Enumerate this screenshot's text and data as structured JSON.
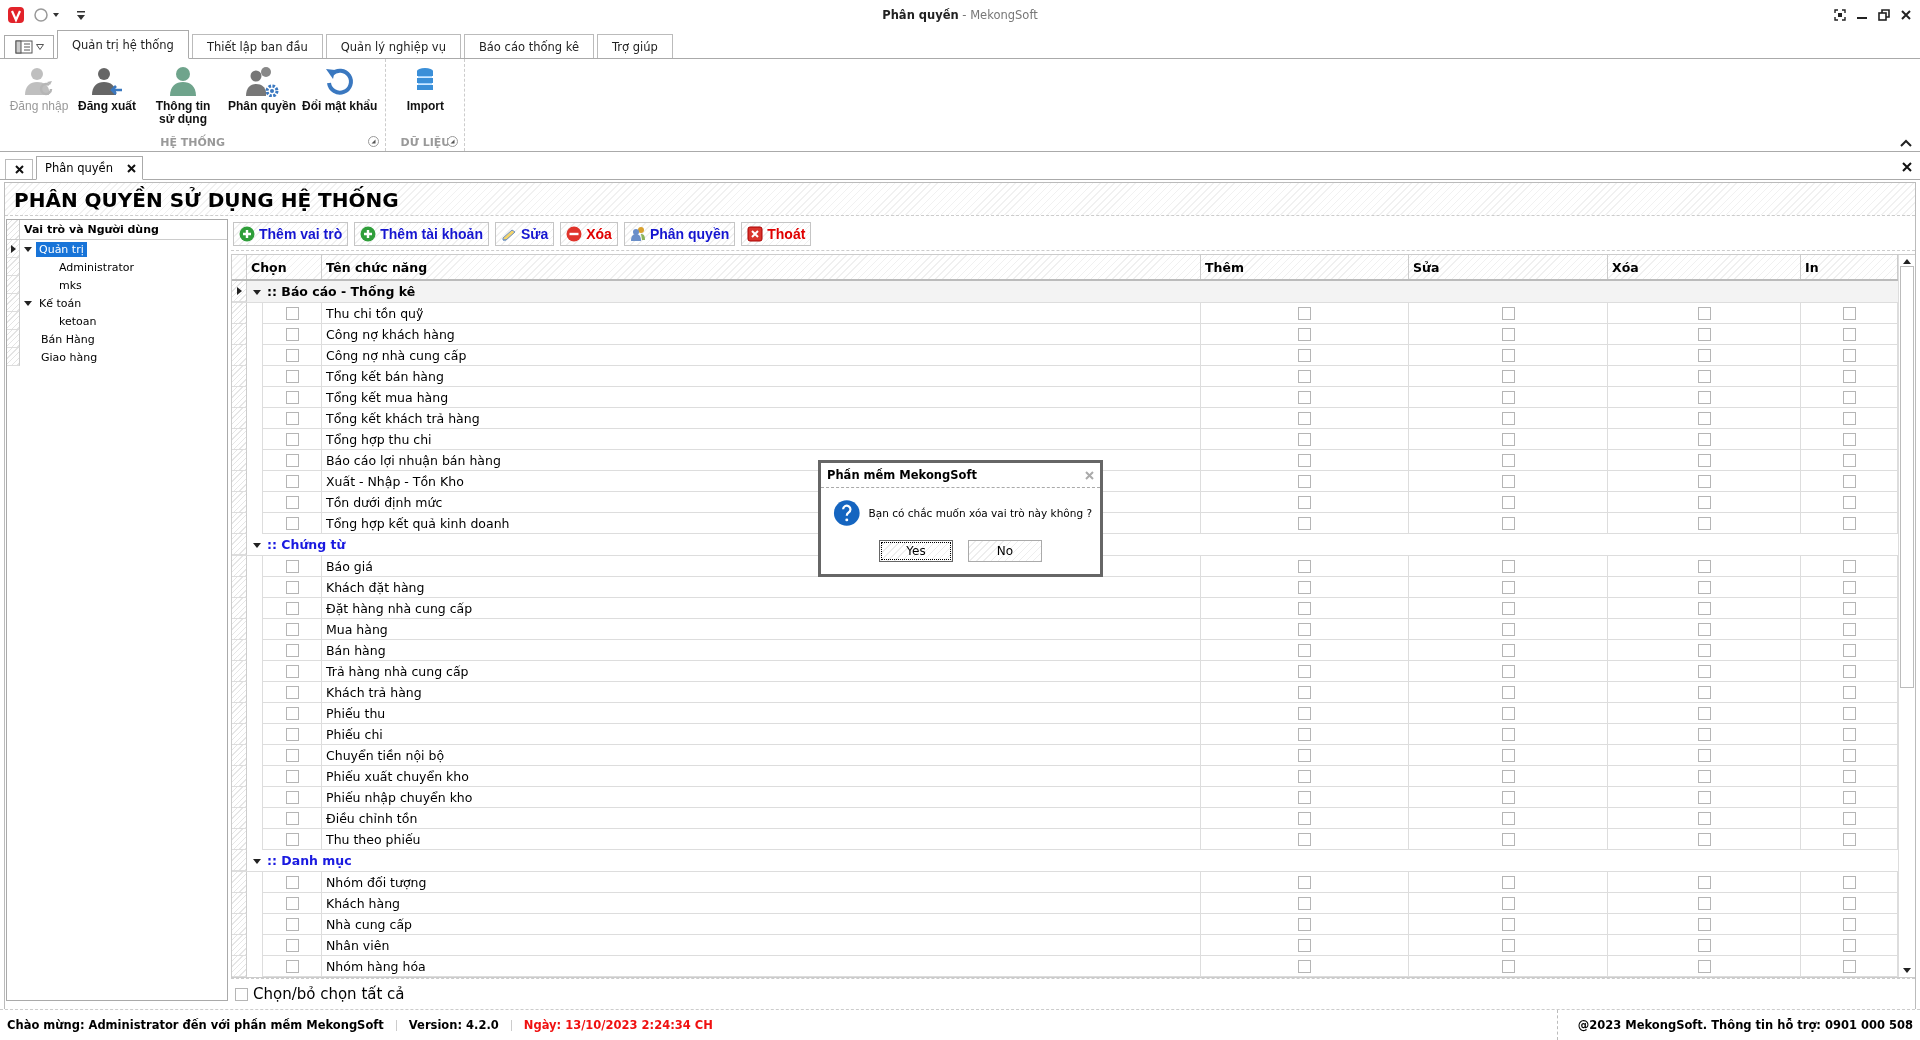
{
  "window": {
    "title": "**Phân quyền** - MekongSoft"
  },
  "ribbon_tabs": [
    {
      "label": "Quản trị hệ thống",
      "selected": true
    },
    {
      "label": "Thiết lập ban đầu",
      "selected": false
    },
    {
      "label": "Quản lý nghiệp vụ",
      "selected": false
    },
    {
      "label": "Báo cáo thống kê",
      "selected": false
    },
    {
      "label": "Trợ giúp",
      "selected": false
    }
  ],
  "ribbon_groups": [
    {
      "label": "HỆ THỐNG",
      "buttons": [
        {
          "label": "Đăng nhập",
          "disabled": true
        },
        {
          "label": "Đăng xuất",
          "disabled": false
        },
        {
          "label": "Thông tin sử dụng",
          "disabled": false
        },
        {
          "label": "Phân quyền",
          "disabled": false
        },
        {
          "label": "Đổi mật khẩu",
          "disabled": false
        }
      ]
    },
    {
      "label": "DỮ LIỆU",
      "buttons": [
        {
          "label": "Import",
          "disabled": false
        }
      ]
    }
  ],
  "document_tabs": [
    {
      "label": "Phân quyền",
      "selected": true
    }
  ],
  "page_title": "PHÂN QUYỀN SỬ DỤNG HỆ THỐNG",
  "tree": {
    "header": "Vai trò và Người dùng",
    "items": [
      {
        "label": "Quản trị",
        "selected": true,
        "expanded": true,
        "children": [
          {
            "label": "Administrator",
            "selected": false
          },
          {
            "label": "mks",
            "selected": false
          }
        ]
      },
      {
        "label": "Kế toán",
        "selected": false,
        "expanded": true,
        "children": [
          {
            "label": "ketoan",
            "selected": false
          }
        ]
      },
      {
        "label": "Bán Hàng",
        "selected": false
      },
      {
        "label": "Giao hàng",
        "selected": false
      }
    ]
  },
  "toolbar": [
    {
      "kind": "add",
      "label": "Thêm vai trò"
    },
    {
      "kind": "add",
      "label": "Thêm tài khoản"
    },
    {
      "kind": "edit",
      "label": "Sửa"
    },
    {
      "kind": "delete",
      "label": "Xóa"
    },
    {
      "kind": "assign",
      "label": "Phân quyền"
    },
    {
      "kind": "exit",
      "label": "Thoát"
    }
  ],
  "table": {
    "columns": [
      "Chọn",
      "Tên chức năng",
      "Thêm",
      "Sửa",
      "Xóa",
      "In"
    ],
    "groups": [
      {
        "title": ":: Báo cáo - Thống kê",
        "expanded": true,
        "focused": true,
        "rows": [
          {
            "name": "Thu chi tồn quỹ",
            "select": false,
            "add": false,
            "edit": false,
            "delete": false,
            "print": false
          },
          {
            "name": "Công nợ khách hàng",
            "select": false,
            "add": false,
            "edit": false,
            "delete": false,
            "print": false
          },
          {
            "name": "Công nợ nhà cung cấp",
            "select": false,
            "add": false,
            "edit": false,
            "delete": false,
            "print": false
          },
          {
            "name": "Tổng kết bán hàng",
            "select": false,
            "add": false,
            "edit": false,
            "delete": false,
            "print": false
          },
          {
            "name": "Tổng kết mua hàng",
            "select": false,
            "add": false,
            "edit": false,
            "delete": false,
            "print": false
          },
          {
            "name": "Tổng kết khách trả hàng",
            "select": false,
            "add": false,
            "edit": false,
            "delete": false,
            "print": false
          },
          {
            "name": "Tổng hợp thu chi",
            "select": false,
            "add": false,
            "edit": false,
            "delete": false,
            "print": false
          },
          {
            "name": "Báo cáo lợi nhuận bán hàng",
            "select": false,
            "add": false,
            "edit": false,
            "delete": false,
            "print": false
          },
          {
            "name": "Xuất - Nhập - Tồn Kho",
            "select": false,
            "add": false,
            "edit": false,
            "delete": false,
            "print": false
          },
          {
            "name": "Tồn dưới định mức",
            "select": false,
            "add": false,
            "edit": false,
            "delete": false,
            "print": false
          },
          {
            "name": "Tổng hợp kết quả kinh doanh",
            "select": false,
            "add": false,
            "edit": false,
            "delete": false,
            "print": false
          }
        ]
      },
      {
        "title": ":: Chứng từ",
        "expanded": true,
        "focused": false,
        "rows": [
          {
            "name": "Báo giá",
            "select": false,
            "add": false,
            "edit": false,
            "delete": false,
            "print": false
          },
          {
            "name": "Khách đặt hàng",
            "select": false,
            "add": false,
            "edit": false,
            "delete": false,
            "print": false
          },
          {
            "name": "Đặt hàng nhà cung cấp",
            "select": false,
            "add": false,
            "edit": false,
            "delete": false,
            "print": false
          },
          {
            "name": "Mua hàng",
            "select": false,
            "add": false,
            "edit": false,
            "delete": false,
            "print": false
          },
          {
            "name": "Bán hàng",
            "select": false,
            "add": false,
            "edit": false,
            "delete": false,
            "print": false
          },
          {
            "name": "Trả hàng nhà cung cấp",
            "select": false,
            "add": false,
            "edit": false,
            "delete": false,
            "print": false
          },
          {
            "name": "Khách trả hàng",
            "select": false,
            "add": false,
            "edit": false,
            "delete": false,
            "print": false
          },
          {
            "name": "Phiếu thu",
            "select": false,
            "add": false,
            "edit": false,
            "delete": false,
            "print": false
          },
          {
            "name": "Phiếu chi",
            "select": false,
            "add": false,
            "edit": false,
            "delete": false,
            "print": false
          },
          {
            "name": "Chuyển tiền nội bộ",
            "select": false,
            "add": false,
            "edit": false,
            "delete": false,
            "print": false
          },
          {
            "name": "Phiếu xuất chuyển kho",
            "select": false,
            "add": false,
            "edit": false,
            "delete": false,
            "print": false
          },
          {
            "name": "Phiếu nhập chuyển kho",
            "select": false,
            "add": false,
            "edit": false,
            "delete": false,
            "print": false
          },
          {
            "name": "Điều chỉnh tồn",
            "select": false,
            "add": false,
            "edit": false,
            "delete": false,
            "print": false
          },
          {
            "name": "Thu theo phiếu",
            "select": false,
            "add": false,
            "edit": false,
            "delete": false,
            "print": false
          }
        ]
      },
      {
        "title": ":: Danh mục",
        "expanded": true,
        "focused": false,
        "rows": [
          {
            "name": "Nhóm đối tượng",
            "select": false,
            "add": false,
            "edit": false,
            "delete": false,
            "print": false
          },
          {
            "name": "Khách hàng",
            "select": false,
            "add": false,
            "edit": false,
            "delete": false,
            "print": false
          },
          {
            "name": "Nhà cung cấp",
            "select": false,
            "add": false,
            "edit": false,
            "delete": false,
            "print": false
          },
          {
            "name": "Nhân viên",
            "select": false,
            "add": false,
            "edit": false,
            "delete": false,
            "print": false
          },
          {
            "name": "Nhóm hàng hóa",
            "select": false,
            "add": false,
            "edit": false,
            "delete": false,
            "print": false
          }
        ]
      }
    ]
  },
  "select_all": {
    "label": "Chọn/bỏ chọn tất cả",
    "checked": false
  },
  "dialog": {
    "title": "Phần mềm MekongSoft",
    "message": "Bạn có chắc muốn xóa vai trò này không ?",
    "buttons": [
      {
        "label": "Yes",
        "selected": true
      },
      {
        "label": "No",
        "selected": false
      }
    ]
  },
  "status_bar": {
    "welcome": "Chào mừng: Administrator đến với phần mềm MekongSoft",
    "version": "Version: 4.2.0",
    "date": "Ngày: 13/10/2023 2:24:34 CH",
    "support": "@2023 MekongSoft. Thông tin hỗ trợ: 0901 000 508"
  }
}
